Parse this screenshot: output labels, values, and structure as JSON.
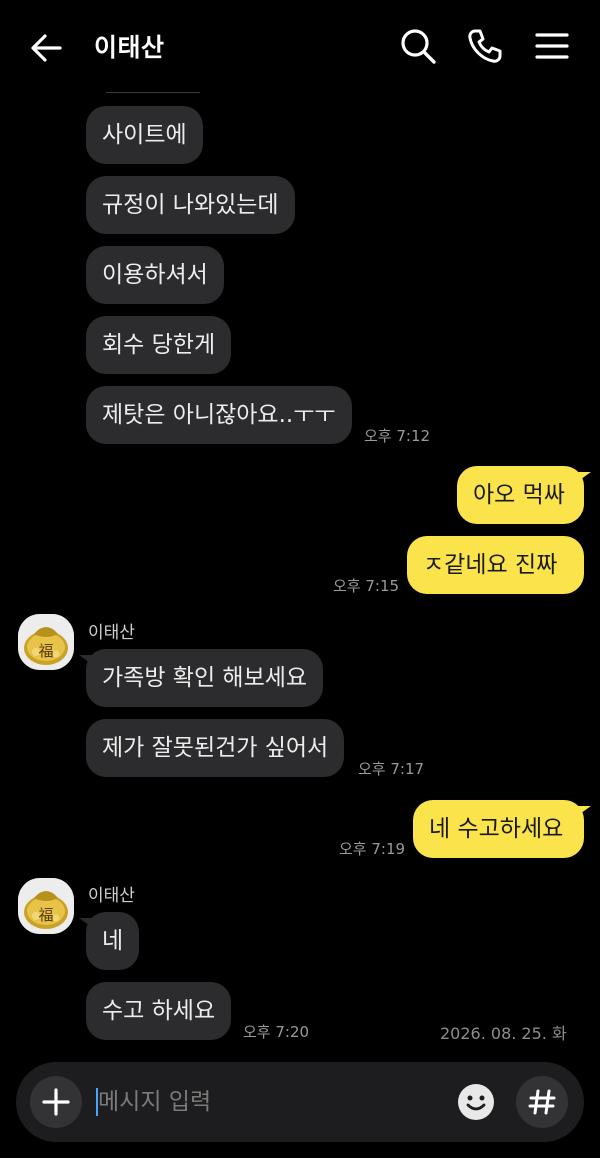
{
  "header": {
    "title": "이태산",
    "icons": [
      "back-arrow-icon",
      "search-icon",
      "phone-icon",
      "menu-icon"
    ]
  },
  "messages": [
    {
      "dir": "in",
      "text": "사이트에"
    },
    {
      "dir": "in",
      "text": "규정이 나와있는데"
    },
    {
      "dir": "in",
      "text": "이용하셔서"
    },
    {
      "dir": "in",
      "text": "회수 당한게"
    },
    {
      "dir": "in",
      "text": "제탓은 아니잖아요..ㅜㅜ",
      "time": "오후 7:12"
    },
    {
      "dir": "out",
      "text": "아오 먹싸"
    },
    {
      "dir": "out",
      "text": "ㅈ같네요 진짜",
      "time": "오후 7:15"
    },
    {
      "dir": "in",
      "sender": "이태산",
      "text": "가족방 확인 해보세요"
    },
    {
      "dir": "in",
      "text": "제가 잘못된건가 싶어서",
      "time": "오후 7:17"
    },
    {
      "dir": "out",
      "text": "네 수고하세요",
      "time": "오후 7:19"
    },
    {
      "dir": "in",
      "sender": "이태산",
      "text": "네"
    },
    {
      "dir": "in",
      "text": "수고 하세요",
      "time": "오후 7:20"
    }
  ],
  "date_badge": "2026. 08. 25. 화",
  "composer": {
    "placeholder": "메시지 입력",
    "plus_icon": "plus-icon",
    "emoji_icon": "emoji-icon",
    "hash_icon": "hash-icon"
  },
  "colors": {
    "background": "#000000",
    "incoming_bubble": "#2c2c2e",
    "outgoing_bubble": "#fae34b"
  }
}
